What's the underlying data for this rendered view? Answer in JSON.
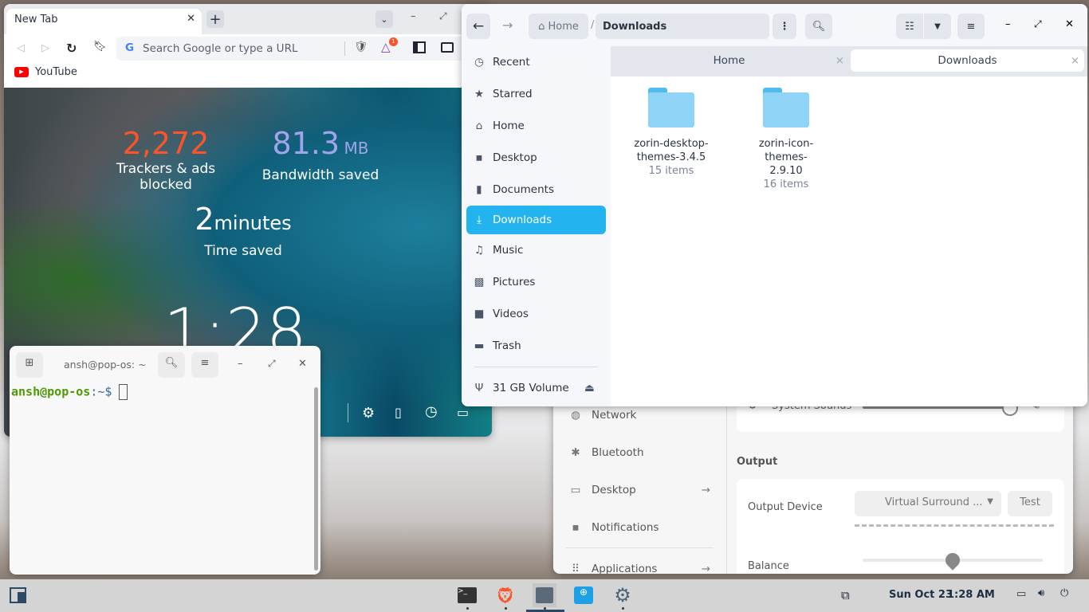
{
  "browser": {
    "tab_title": "New Tab",
    "url_placeholder": "Search Google or type a URL",
    "rewards_badge": "1",
    "bookmarks": [
      {
        "label": "YouTube"
      }
    ],
    "stats": {
      "trackers_value": "2,272",
      "trackers_label": "Trackers & ads blocked",
      "bandwidth_value": "81.3",
      "bandwidth_unit": "MB",
      "bandwidth_label": "Bandwidth saved",
      "time_value": "2",
      "time_unit": "minutes",
      "time_label": "Time saved"
    },
    "clock": "1:28",
    "colors": {
      "trackers": "#fb542b",
      "bandwidth": "#a0a5eb"
    }
  },
  "files": {
    "path": [
      "Home",
      "Downloads"
    ],
    "sidebar": [
      {
        "label": "Recent",
        "icon": "clock-icon"
      },
      {
        "label": "Starred",
        "icon": "star-icon"
      },
      {
        "label": "Home",
        "icon": "home-icon"
      },
      {
        "label": "Desktop",
        "icon": "desktop-icon"
      },
      {
        "label": "Documents",
        "icon": "document-icon"
      },
      {
        "label": "Downloads",
        "icon": "download-icon",
        "selected": true
      },
      {
        "label": "Music",
        "icon": "music-icon"
      },
      {
        "label": "Pictures",
        "icon": "picture-icon"
      },
      {
        "label": "Videos",
        "icon": "video-icon"
      },
      {
        "label": "Trash",
        "icon": "trash-icon"
      }
    ],
    "volume": "31 GB Volume",
    "tabs": [
      "Home",
      "Downloads"
    ],
    "items": [
      {
        "name": "zorin-desktop-themes-3.4.5",
        "count": "15 items"
      },
      {
        "name": "zorin-icon-themes-2.9.10",
        "count": "16 items"
      }
    ],
    "accent": "#23b4f0"
  },
  "settings": {
    "nav": [
      {
        "label": "Network"
      },
      {
        "label": "Bluetooth"
      },
      {
        "label": "Desktop"
      },
      {
        "label": "Notifications"
      },
      {
        "label": "Applications"
      }
    ],
    "system_sounds": "System Sounds",
    "output_heading": "Output",
    "output_device_label": "Output Device",
    "output_device_value": "Virtual Surround ...",
    "test_label": "Test",
    "balance_label": "Balance",
    "balance_value": 0.5,
    "system_sounds_volume": 1.0
  },
  "terminal": {
    "title": "ansh@pop-os: ~",
    "prompt_user": "ansh@pop-os",
    "prompt_path": ":~$"
  },
  "taskbar": {
    "date": "Sun Oct 23",
    "time": "1:28 AM"
  }
}
